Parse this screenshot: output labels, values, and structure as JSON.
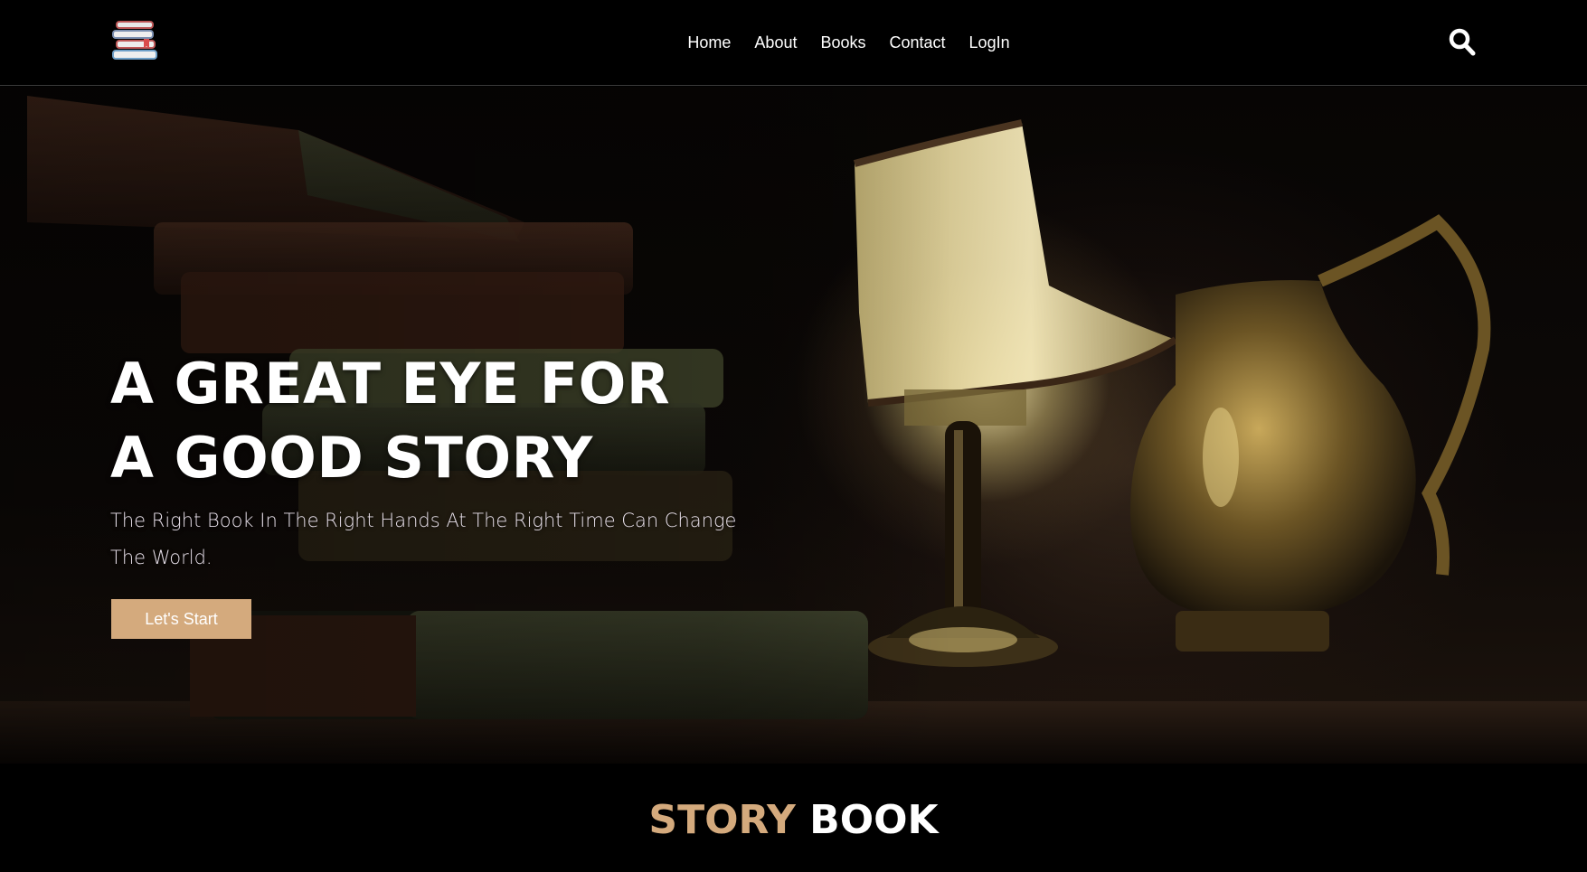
{
  "nav": {
    "logo_icon": "stacked-books-icon",
    "links": [
      "Home",
      "About",
      "Books",
      "Contact",
      "LogIn"
    ],
    "search_icon": "search-icon"
  },
  "hero": {
    "title_line1": "A GREAT EYE FOR",
    "title_line2": "A GOOD STORY",
    "subtitle": "The Right Book In The Right Hands At The Right Time Can Change The World.",
    "cta_label": "Let's Start"
  },
  "section": {
    "title_accent": "STORY",
    "title_main": "BOOK"
  },
  "colors": {
    "accent": "#d4aa7d",
    "background": "#000000",
    "text": "#ffffff"
  }
}
